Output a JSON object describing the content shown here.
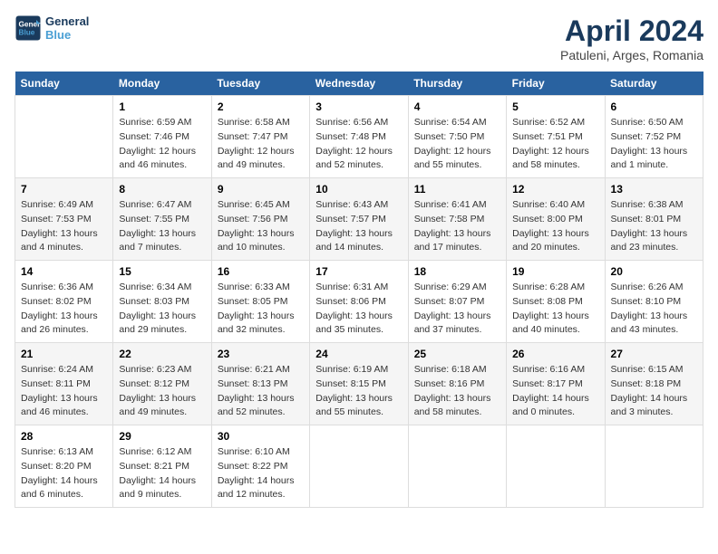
{
  "header": {
    "logo_line1": "General",
    "logo_line2": "Blue",
    "title": "April 2024",
    "subtitle": "Patuleni, Arges, Romania"
  },
  "weekdays": [
    "Sunday",
    "Monday",
    "Tuesday",
    "Wednesday",
    "Thursday",
    "Friday",
    "Saturday"
  ],
  "weeks": [
    [
      {
        "day": "",
        "sunrise": "",
        "sunset": "",
        "daylight": ""
      },
      {
        "day": "1",
        "sunrise": "Sunrise: 6:59 AM",
        "sunset": "Sunset: 7:46 PM",
        "daylight": "Daylight: 12 hours and 46 minutes."
      },
      {
        "day": "2",
        "sunrise": "Sunrise: 6:58 AM",
        "sunset": "Sunset: 7:47 PM",
        "daylight": "Daylight: 12 hours and 49 minutes."
      },
      {
        "day": "3",
        "sunrise": "Sunrise: 6:56 AM",
        "sunset": "Sunset: 7:48 PM",
        "daylight": "Daylight: 12 hours and 52 minutes."
      },
      {
        "day": "4",
        "sunrise": "Sunrise: 6:54 AM",
        "sunset": "Sunset: 7:50 PM",
        "daylight": "Daylight: 12 hours and 55 minutes."
      },
      {
        "day": "5",
        "sunrise": "Sunrise: 6:52 AM",
        "sunset": "Sunset: 7:51 PM",
        "daylight": "Daylight: 12 hours and 58 minutes."
      },
      {
        "day": "6",
        "sunrise": "Sunrise: 6:50 AM",
        "sunset": "Sunset: 7:52 PM",
        "daylight": "Daylight: 13 hours and 1 minute."
      }
    ],
    [
      {
        "day": "7",
        "sunrise": "Sunrise: 6:49 AM",
        "sunset": "Sunset: 7:53 PM",
        "daylight": "Daylight: 13 hours and 4 minutes."
      },
      {
        "day": "8",
        "sunrise": "Sunrise: 6:47 AM",
        "sunset": "Sunset: 7:55 PM",
        "daylight": "Daylight: 13 hours and 7 minutes."
      },
      {
        "day": "9",
        "sunrise": "Sunrise: 6:45 AM",
        "sunset": "Sunset: 7:56 PM",
        "daylight": "Daylight: 13 hours and 10 minutes."
      },
      {
        "day": "10",
        "sunrise": "Sunrise: 6:43 AM",
        "sunset": "Sunset: 7:57 PM",
        "daylight": "Daylight: 13 hours and 14 minutes."
      },
      {
        "day": "11",
        "sunrise": "Sunrise: 6:41 AM",
        "sunset": "Sunset: 7:58 PM",
        "daylight": "Daylight: 13 hours and 17 minutes."
      },
      {
        "day": "12",
        "sunrise": "Sunrise: 6:40 AM",
        "sunset": "Sunset: 8:00 PM",
        "daylight": "Daylight: 13 hours and 20 minutes."
      },
      {
        "day": "13",
        "sunrise": "Sunrise: 6:38 AM",
        "sunset": "Sunset: 8:01 PM",
        "daylight": "Daylight: 13 hours and 23 minutes."
      }
    ],
    [
      {
        "day": "14",
        "sunrise": "Sunrise: 6:36 AM",
        "sunset": "Sunset: 8:02 PM",
        "daylight": "Daylight: 13 hours and 26 minutes."
      },
      {
        "day": "15",
        "sunrise": "Sunrise: 6:34 AM",
        "sunset": "Sunset: 8:03 PM",
        "daylight": "Daylight: 13 hours and 29 minutes."
      },
      {
        "day": "16",
        "sunrise": "Sunrise: 6:33 AM",
        "sunset": "Sunset: 8:05 PM",
        "daylight": "Daylight: 13 hours and 32 minutes."
      },
      {
        "day": "17",
        "sunrise": "Sunrise: 6:31 AM",
        "sunset": "Sunset: 8:06 PM",
        "daylight": "Daylight: 13 hours and 35 minutes."
      },
      {
        "day": "18",
        "sunrise": "Sunrise: 6:29 AM",
        "sunset": "Sunset: 8:07 PM",
        "daylight": "Daylight: 13 hours and 37 minutes."
      },
      {
        "day": "19",
        "sunrise": "Sunrise: 6:28 AM",
        "sunset": "Sunset: 8:08 PM",
        "daylight": "Daylight: 13 hours and 40 minutes."
      },
      {
        "day": "20",
        "sunrise": "Sunrise: 6:26 AM",
        "sunset": "Sunset: 8:10 PM",
        "daylight": "Daylight: 13 hours and 43 minutes."
      }
    ],
    [
      {
        "day": "21",
        "sunrise": "Sunrise: 6:24 AM",
        "sunset": "Sunset: 8:11 PM",
        "daylight": "Daylight: 13 hours and 46 minutes."
      },
      {
        "day": "22",
        "sunrise": "Sunrise: 6:23 AM",
        "sunset": "Sunset: 8:12 PM",
        "daylight": "Daylight: 13 hours and 49 minutes."
      },
      {
        "day": "23",
        "sunrise": "Sunrise: 6:21 AM",
        "sunset": "Sunset: 8:13 PM",
        "daylight": "Daylight: 13 hours and 52 minutes."
      },
      {
        "day": "24",
        "sunrise": "Sunrise: 6:19 AM",
        "sunset": "Sunset: 8:15 PM",
        "daylight": "Daylight: 13 hours and 55 minutes."
      },
      {
        "day": "25",
        "sunrise": "Sunrise: 6:18 AM",
        "sunset": "Sunset: 8:16 PM",
        "daylight": "Daylight: 13 hours and 58 minutes."
      },
      {
        "day": "26",
        "sunrise": "Sunrise: 6:16 AM",
        "sunset": "Sunset: 8:17 PM",
        "daylight": "Daylight: 14 hours and 0 minutes."
      },
      {
        "day": "27",
        "sunrise": "Sunrise: 6:15 AM",
        "sunset": "Sunset: 8:18 PM",
        "daylight": "Daylight: 14 hours and 3 minutes."
      }
    ],
    [
      {
        "day": "28",
        "sunrise": "Sunrise: 6:13 AM",
        "sunset": "Sunset: 8:20 PM",
        "daylight": "Daylight: 14 hours and 6 minutes."
      },
      {
        "day": "29",
        "sunrise": "Sunrise: 6:12 AM",
        "sunset": "Sunset: 8:21 PM",
        "daylight": "Daylight: 14 hours and 9 minutes."
      },
      {
        "day": "30",
        "sunrise": "Sunrise: 6:10 AM",
        "sunset": "Sunset: 8:22 PM",
        "daylight": "Daylight: 14 hours and 12 minutes."
      },
      {
        "day": "",
        "sunrise": "",
        "sunset": "",
        "daylight": ""
      },
      {
        "day": "",
        "sunrise": "",
        "sunset": "",
        "daylight": ""
      },
      {
        "day": "",
        "sunrise": "",
        "sunset": "",
        "daylight": ""
      },
      {
        "day": "",
        "sunrise": "",
        "sunset": "",
        "daylight": ""
      }
    ]
  ]
}
